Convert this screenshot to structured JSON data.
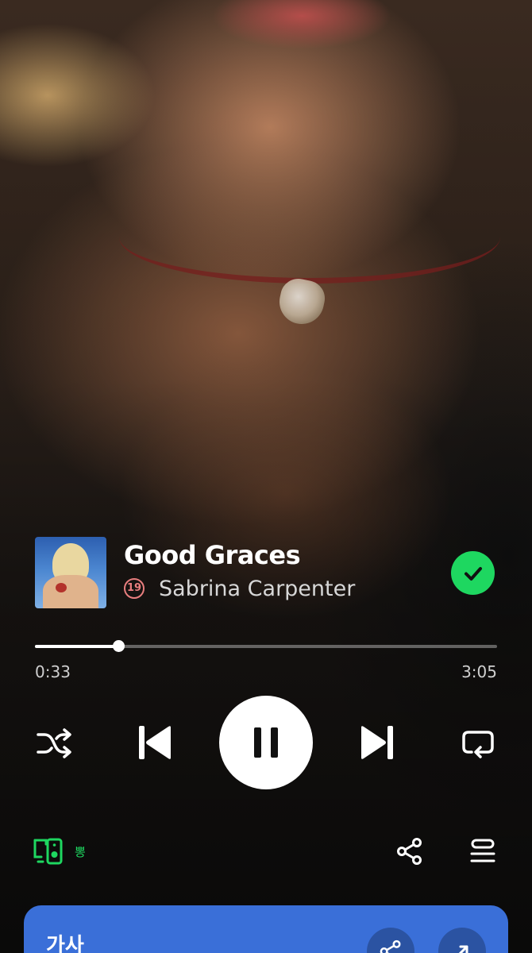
{
  "track": {
    "title": "Good Graces",
    "explicit_badge": "19",
    "artist": "Sabrina Carpenter",
    "saved": true
  },
  "progress": {
    "elapsed": "0:33",
    "total": "3:05",
    "fraction": 0.181
  },
  "controls": {
    "shuffle_icon": "shuffle-icon",
    "previous_icon": "skip-previous-icon",
    "play_pause_icon": "pause-icon",
    "next_icon": "skip-next-icon",
    "repeat_icon": "repeat-icon"
  },
  "bottom_bar": {
    "device_label": "뽕",
    "device_icon": "connect-device-icon",
    "share_icon": "share-icon",
    "queue_icon": "queue-icon"
  },
  "lyrics": {
    "title": "가사"
  },
  "colors": {
    "accent_green": "#1ed760",
    "explicit_red": "#e87e7e",
    "lyrics_card": "#3a6fd8"
  }
}
